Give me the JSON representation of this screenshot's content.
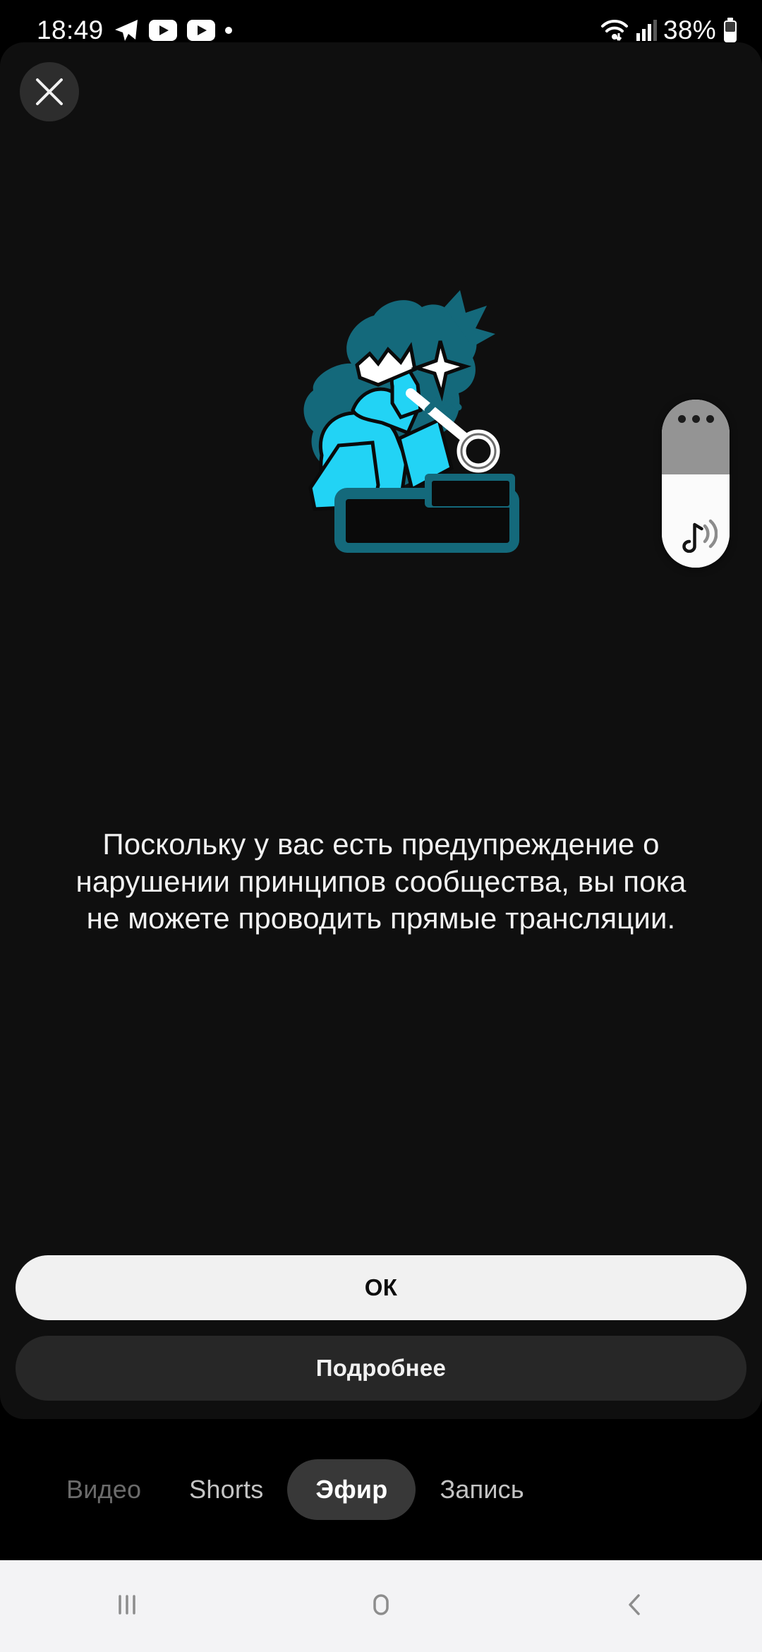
{
  "status_bar": {
    "time": "18:49",
    "battery_percent": "38%",
    "left_icons": [
      "telegram-icon",
      "youtube-icon",
      "youtube-icon",
      "dot-indicator-icon"
    ],
    "right_icons": [
      "wifi-icon",
      "cellular-signal-icon",
      "battery-icon"
    ]
  },
  "dialog": {
    "close_icon": "close-icon",
    "illustration_name": "person-with-key-illustration",
    "illustration_colors": {
      "cyan": "#22D3F5",
      "teal": "#14697B",
      "white": "#FFFFFF",
      "black": "#0A0A0A"
    },
    "message": "Поскольку у вас есть предупреждение о нарушении принципов сообщества, вы пока не можете проводить прямые трансляции.",
    "buttons": {
      "primary_label": "ОК",
      "secondary_label": "Подробнее"
    },
    "background_color": "#0f0f0f"
  },
  "mode_tabs": {
    "items": [
      {
        "label": "Видео",
        "state": "inactive-dim"
      },
      {
        "label": "Shorts",
        "state": "inactive"
      },
      {
        "label": "Эфир",
        "state": "active"
      },
      {
        "label": "Запись",
        "state": "inactive"
      }
    ],
    "active_pill_color": "#383838"
  },
  "music_widget": {
    "menu_icon": "three-dots-icon",
    "sound_icon": "music-note-waves-icon",
    "top_color": "#949494",
    "bottom_color": "#fbfbfb"
  },
  "nav_bar": {
    "background_color": "#f3f3f5",
    "buttons": [
      {
        "name": "recents-button",
        "icon": "recents-icon"
      },
      {
        "name": "home-button",
        "icon": "home-icon"
      },
      {
        "name": "back-button",
        "icon": "back-chevron-icon"
      }
    ]
  }
}
